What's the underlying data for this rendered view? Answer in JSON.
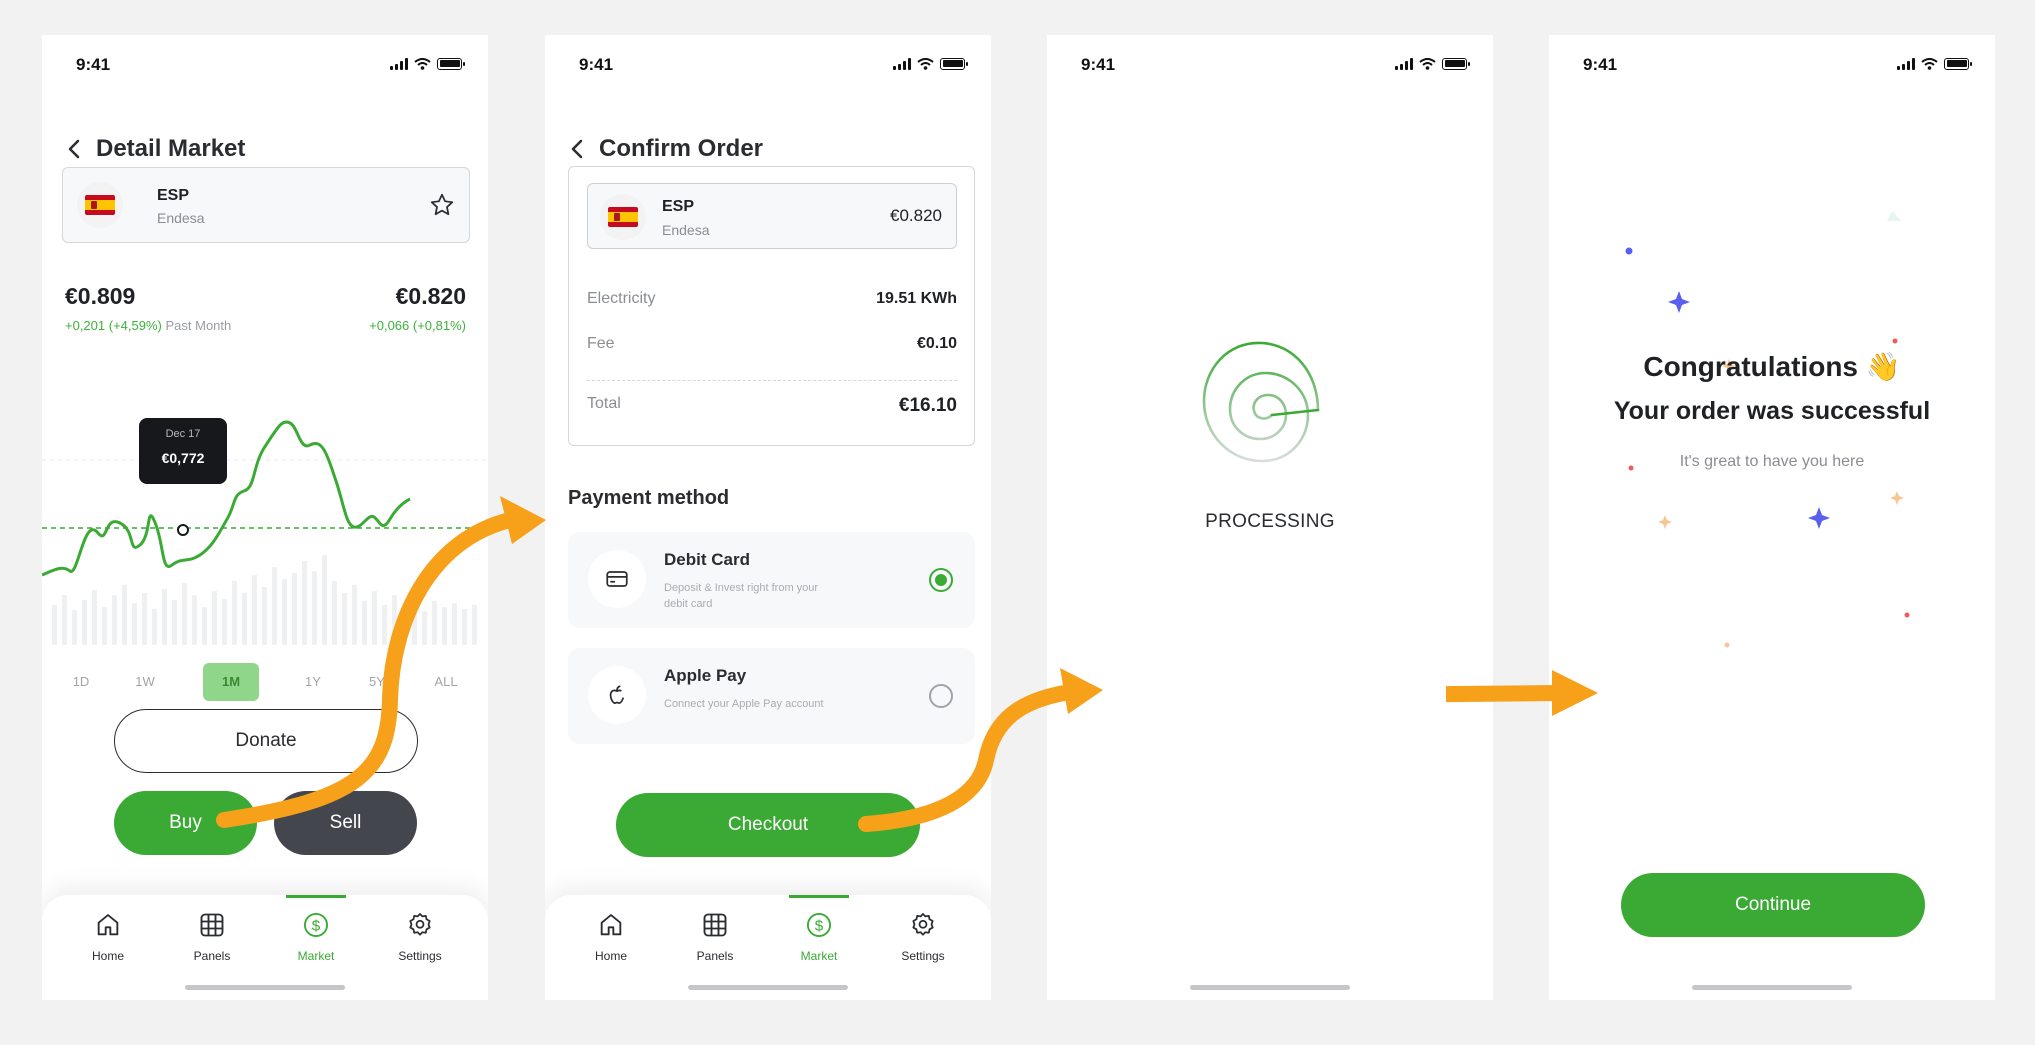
{
  "status": {
    "time": "9:41"
  },
  "screen1": {
    "title": "Detail Market",
    "asset": {
      "code": "ESP",
      "name": "Endesa"
    },
    "price_left": {
      "value": "€0.809",
      "change": "+0,201 (+4,59%)",
      "period": "Past Month"
    },
    "price_right": {
      "value": "€0.820",
      "change": "+0,066 (+0,81%)"
    },
    "tooltip": {
      "date": "Dec 17",
      "value": "€0,772"
    },
    "ranges": [
      {
        "label": "1D",
        "active": false
      },
      {
        "label": "1W",
        "active": false
      },
      {
        "label": "1M",
        "active": true
      },
      {
        "label": "1Y",
        "active": false
      },
      {
        "label": "5Y",
        "active": false
      },
      {
        "label": "ALL",
        "active": false
      }
    ],
    "donate_label": "Donate",
    "buy_label": "Buy",
    "sell_label": "Sell"
  },
  "screen2": {
    "title": "Confirm Order",
    "asset": {
      "code": "ESP",
      "name": "Endesa",
      "price": "€0.820"
    },
    "rows": {
      "electricity": {
        "label": "Electricity",
        "value": "19.51 KWh"
      },
      "fee": {
        "label": "Fee",
        "value": "€0.10"
      },
      "total": {
        "label": "Total",
        "value": "€16.10"
      }
    },
    "payment_title": "Payment method",
    "payment_methods": [
      {
        "title": "Debit Card",
        "desc": "Deposit & Invest right from your debit card",
        "selected": true
      },
      {
        "title": "Apple Pay",
        "desc": "Connect your Apple Pay account",
        "selected": false
      }
    ],
    "checkout_label": "Checkout"
  },
  "screen3": {
    "processing_label": "PROCESSING"
  },
  "screen4": {
    "congrats": "Congratulations 👋",
    "success": "Your order was successful",
    "sub": "It's great to have you here",
    "continue_label": "Continue"
  },
  "tabs": [
    {
      "label": "Home",
      "icon": "home-icon"
    },
    {
      "label": "Panels",
      "icon": "grid-icon"
    },
    {
      "label": "Market",
      "icon": "dollar-circle-icon"
    },
    {
      "label": "Settings",
      "icon": "gear-icon"
    }
  ],
  "active_tab": "Market",
  "colors": {
    "accent": "#3aaa34",
    "dark": "#43474d",
    "arrow": "#f7a01a"
  }
}
